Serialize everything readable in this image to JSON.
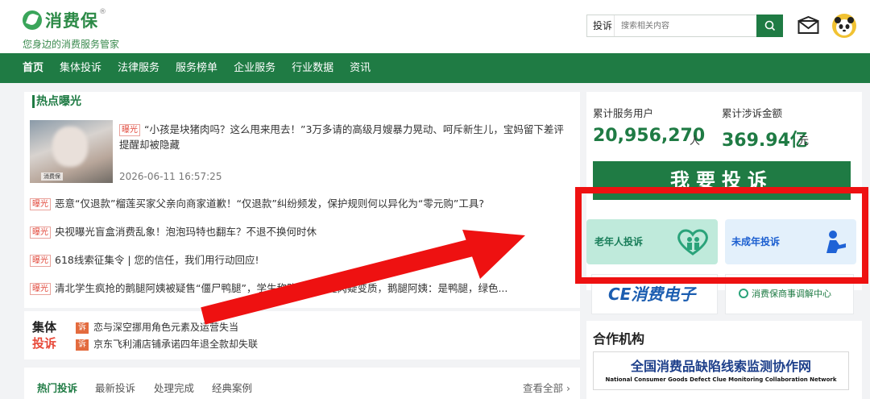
{
  "header": {
    "logo_title": "消费保",
    "logo_slogan": "您身边的消费服务管家",
    "search_type": "投诉",
    "search_placeholder": "搜索相关内容"
  },
  "nav": {
    "items": [
      "首页",
      "集体投诉",
      "法律服务",
      "服务榜单",
      "企业服务",
      "行业数据",
      "资讯"
    ]
  },
  "hot": {
    "title": "热点曝光",
    "tag": "曝光",
    "featured_title": "“小孩是块猪肉吗？这么甩来甩去！”3万多请的高级月嫂暴力晃动、呵斥新生儿，宝妈留下差评提醒却被隐藏",
    "featured_date": "2026-06-11 16:57:25",
    "thumb_caption": "消费保",
    "news": [
      "恶意“仅退款”榴莲买家父亲向商家道歉！“仅退款”纠纷频发，保护规则何以异化为“零元购”工具?",
      "央视曝光盲盒消费乱象！泡泡玛特也翻车？不退不换何时休",
      "618线索征集令 | 您的信任，我们用行动回应!",
      "清北学生疯抢的鹅腿阿姨被疑售“僵尸鸭腿”，学生称购买后鸭腿肉疑变质，鹅腿阿姨：是鸭腿，绿色..."
    ]
  },
  "group": {
    "logo_line1": "集体",
    "logo_line2": "投诉",
    "tag": "诉",
    "items": [
      "恋与深空挪用角色元素及运营失当",
      "京东飞利浦店铺承诺四年退全款却失联"
    ]
  },
  "tabs": {
    "items": [
      "热门投诉",
      "最新投诉",
      "处理完成",
      "经典案例"
    ],
    "view_all": "查看全部"
  },
  "stats": {
    "users_label": "累计服务用户",
    "users_value": "20,956,270",
    "users_unit": "人",
    "amount_label": "累计涉诉金额",
    "amount_value": "369.94亿",
    "amount_unit": "元",
    "complain_button": "我要投诉",
    "elder_label": "老年人投诉",
    "minor_label": "未成年投诉"
  },
  "partners": {
    "ce_label": "CE消费电子",
    "mediation_label": "消费保商事调解中心",
    "title": "合作机构",
    "coop_cn": "全国消费品缺陷线索监测协作网",
    "coop_en": "National Consumer Goods Defect Clue Monitoring Collaboration Network"
  },
  "colors": {
    "brand_green": "#1f7b44",
    "tag_red": "#e24a3d",
    "annotation_red": "#ee1111"
  }
}
